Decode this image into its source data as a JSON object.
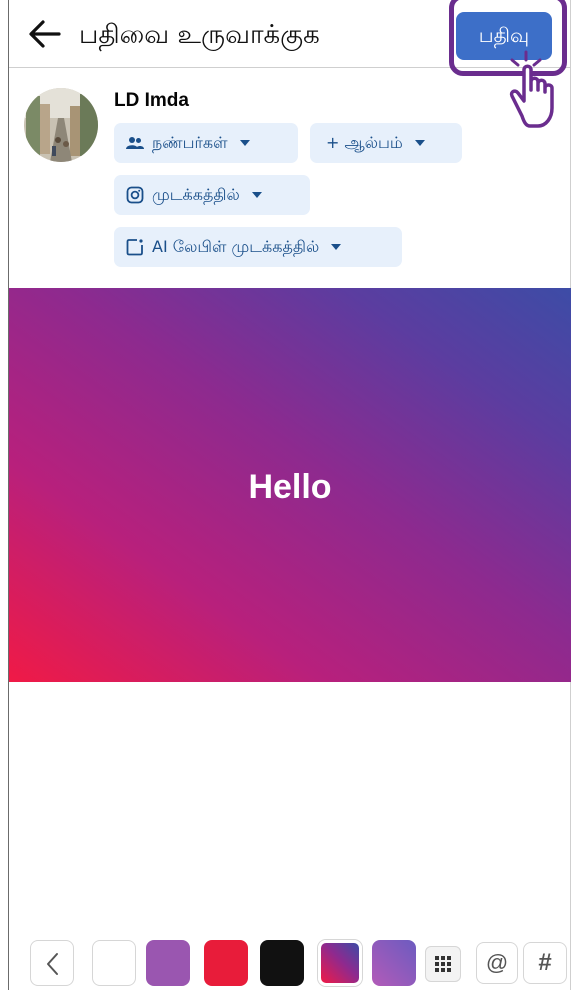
{
  "header": {
    "title": "பதிவை உருவாக்குக",
    "post_label": "பதிவு"
  },
  "profile": {
    "name": "LD Imda",
    "audience_label": "நண்பர்கள்",
    "album_label": "+ ஆல்பம்",
    "instagram_label": "முடக்கத்தில்",
    "ai_label_label": "AI லேபிள் முடக்கத்தில்"
  },
  "post": {
    "text": "Hello",
    "background": [
      "#f01a46",
      "#8d2a8f",
      "#3d4ca6"
    ]
  },
  "toolbar": {
    "at_symbol": "@",
    "hash_symbol": "#",
    "swatches": [
      "#ffffff",
      "#9a56b0",
      "#e81c3a",
      "#111111",
      "gradient-red-purple-blue",
      "gradient-pink-violet"
    ]
  },
  "colors": {
    "accent": "#3d6fc8",
    "highlight": "#6a2d8e",
    "pill_bg": "#e7f0fb",
    "pill_text": "#1a4f8a"
  },
  "icons": [
    "back-arrow-icon",
    "friends-icon",
    "caret-down-icon",
    "instagram-icon",
    "ai-label-icon",
    "hand-pointer-icon",
    "chevron-left-icon",
    "grid-icon"
  ]
}
